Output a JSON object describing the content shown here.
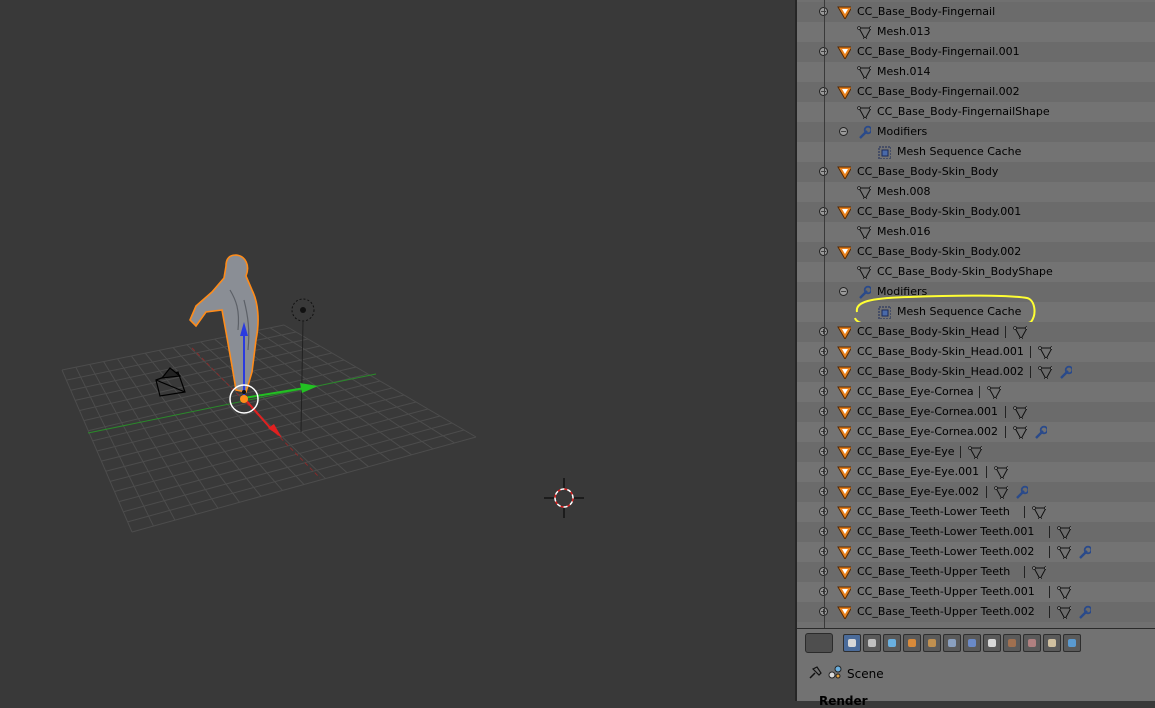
{
  "outliner": {
    "rows": [
      {
        "label": "CC_Base_Body-Fingernail",
        "type": "object",
        "expander": "minus",
        "extras": []
      },
      {
        "label": "Mesh.013",
        "type": "mesh",
        "expander": "",
        "extras": []
      },
      {
        "label": "CC_Base_Body-Fingernail.001",
        "type": "object",
        "expander": "minus",
        "extras": []
      },
      {
        "label": "Mesh.014",
        "type": "mesh",
        "expander": "",
        "extras": []
      },
      {
        "label": "CC_Base_Body-Fingernail.002",
        "type": "object",
        "expander": "minus",
        "extras": []
      },
      {
        "label": "CC_Base_Body-FingernailShape",
        "type": "mesh",
        "expander": "",
        "extras": []
      },
      {
        "label": "Modifiers",
        "type": "modifiers",
        "expander": "minus",
        "extras": []
      },
      {
        "label": "Mesh Sequence Cache",
        "type": "cache",
        "expander": "",
        "extras": []
      },
      {
        "label": "CC_Base_Body-Skin_Body",
        "type": "object",
        "expander": "minus",
        "extras": []
      },
      {
        "label": "Mesh.008",
        "type": "mesh",
        "expander": "",
        "extras": []
      },
      {
        "label": "CC_Base_Body-Skin_Body.001",
        "type": "object",
        "expander": "minus",
        "extras": []
      },
      {
        "label": "Mesh.016",
        "type": "mesh",
        "expander": "",
        "extras": []
      },
      {
        "label": "CC_Base_Body-Skin_Body.002",
        "type": "object",
        "expander": "minus",
        "extras": []
      },
      {
        "label": "CC_Base_Body-Skin_BodyShape",
        "type": "mesh",
        "expander": "",
        "extras": []
      },
      {
        "label": "Modifiers",
        "type": "modifiers",
        "expander": "minus",
        "extras": []
      },
      {
        "label": "Mesh Sequence Cache",
        "type": "cache",
        "expander": "",
        "extras": [],
        "highlighted": true
      },
      {
        "label": "CC_Base_Body-Skin_Head",
        "type": "object",
        "expander": "plus",
        "extras": [
          "mesh"
        ]
      },
      {
        "label": "CC_Base_Body-Skin_Head.001",
        "type": "object",
        "expander": "plus",
        "extras": [
          "mesh"
        ]
      },
      {
        "label": "CC_Base_Body-Skin_Head.002",
        "type": "object",
        "expander": "plus",
        "extras": [
          "mesh",
          "wrench"
        ]
      },
      {
        "label": "CC_Base_Eye-Cornea",
        "type": "object",
        "expander": "plus",
        "extras": [
          "mesh"
        ]
      },
      {
        "label": "CC_Base_Eye-Cornea.001",
        "type": "object",
        "expander": "plus",
        "extras": [
          "mesh"
        ]
      },
      {
        "label": "CC_Base_Eye-Cornea.002",
        "type": "object",
        "expander": "plus",
        "extras": [
          "mesh",
          "wrench"
        ]
      },
      {
        "label": "CC_Base_Eye-Eye",
        "type": "object",
        "expander": "plus",
        "extras": [
          "mesh"
        ]
      },
      {
        "label": "CC_Base_Eye-Eye.001",
        "type": "object",
        "expander": "plus",
        "extras": [
          "mesh"
        ]
      },
      {
        "label": "CC_Base_Eye-Eye.002",
        "type": "object",
        "expander": "plus",
        "extras": [
          "mesh",
          "wrench"
        ]
      },
      {
        "label": "CC_Base_Teeth-Lower Teeth",
        "type": "object",
        "expander": "plus",
        "extras": [
          "mesh"
        ]
      },
      {
        "label": "CC_Base_Teeth-Lower Teeth.001",
        "type": "object",
        "expander": "plus",
        "extras": [
          "mesh"
        ]
      },
      {
        "label": "CC_Base_Teeth-Lower Teeth.002",
        "type": "object",
        "expander": "plus",
        "extras": [
          "mesh",
          "wrench"
        ]
      },
      {
        "label": "CC_Base_Teeth-Upper Teeth",
        "type": "object",
        "expander": "plus",
        "extras": [
          "mesh"
        ]
      },
      {
        "label": "CC_Base_Teeth-Upper Teeth.001",
        "type": "object",
        "expander": "plus",
        "extras": [
          "mesh"
        ]
      },
      {
        "label": "CC_Base_Teeth-Upper Teeth.002",
        "type": "object",
        "expander": "plus",
        "extras": [
          "mesh",
          "wrench"
        ]
      }
    ]
  },
  "properties": {
    "tabs": [
      "render-icon",
      "render-layers-icon",
      "scene-icon",
      "world-icon",
      "object-icon",
      "constraints-icon",
      "modifiers-icon",
      "data-icon",
      "material-icon",
      "texture-icon",
      "particles-icon",
      "physics-icon"
    ],
    "active_tab": 0,
    "scene_label": "Scene",
    "panel_label": "Render"
  },
  "colors": {
    "viewport_bg": "#393939",
    "outliner_bg": "#707070",
    "highlight": "#ffff33",
    "object_orange": "#e8821e",
    "selection_outline": "#ff8c1a"
  }
}
